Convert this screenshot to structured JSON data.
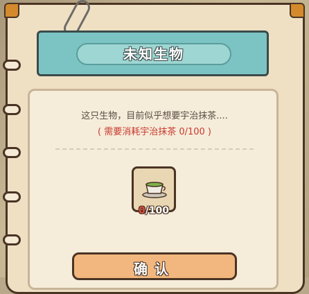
{
  "dialog": {
    "title": "未知生物",
    "description": "这只生物，目前似乎想要宇治抹茶....",
    "cost_text": "( 需要消耗宇治抹茶  0/100 )",
    "item": {
      "name_icon": "matcha-tea-cup-icon",
      "owned": "0",
      "required": "/100"
    },
    "confirm_label": "确认"
  },
  "colors": {
    "title_bar": "#7cc4c4",
    "cost_text": "#c83a2e",
    "confirm_button": "#f2b77e",
    "border": "#4a3424"
  }
}
